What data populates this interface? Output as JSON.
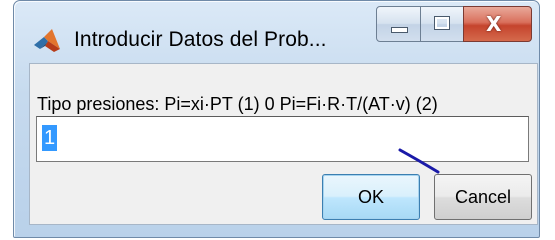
{
  "window": {
    "title": "Introducir Datos del Prob...",
    "app_icon": "matlab-logo-icon",
    "controls": {
      "minimize_icon": "minimize-icon",
      "maximize_icon": "maximize-icon",
      "close_icon": "close-icon",
      "close_glyph": "X"
    }
  },
  "dialog": {
    "prompt": "Tipo presiones: Pi=xi·PT (1) 0 Pi=Fi·R·T/(AT·v) (2)",
    "input_value": "1",
    "ok_label": "OK",
    "cancel_label": "Cancel"
  },
  "colors": {
    "selection": "#3399ff",
    "annotation_stroke": "#1a1aa8"
  }
}
